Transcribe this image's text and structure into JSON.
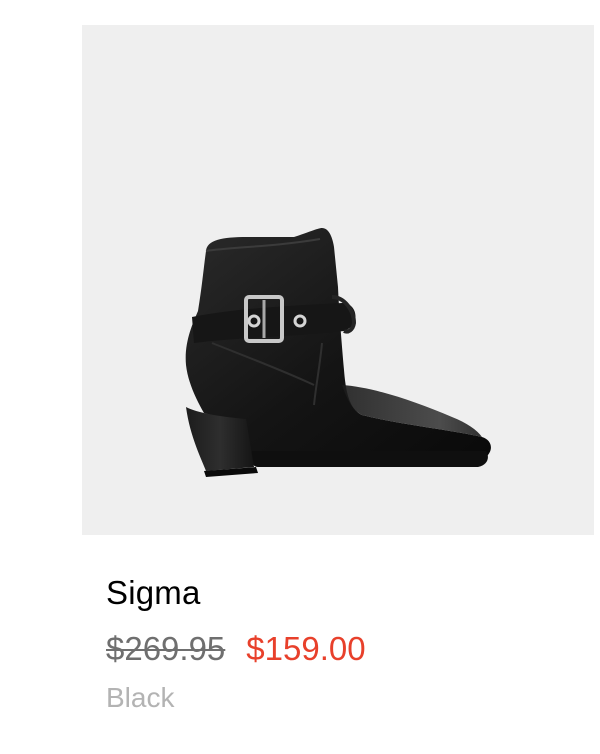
{
  "product": {
    "name": "Sigma",
    "price_original": "$269.95",
    "price_sale": "$159.00",
    "color": "Black",
    "image_subject": "ankle-boot-image"
  },
  "colors": {
    "image_background": "#efefef",
    "name_text": "#000000",
    "original_price_text": "#6f6f6f",
    "sale_price_text": "#e8402b",
    "color_text": "#b3b3b3",
    "boot_leather": "#1a1a1a",
    "buckle_metal": "#c8c8c8"
  }
}
